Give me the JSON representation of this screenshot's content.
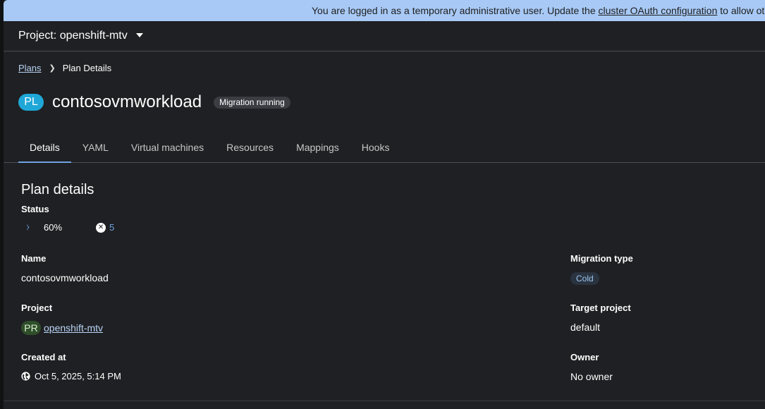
{
  "banner": {
    "text_before": "You are logged in as a temporary administrative user. Update the ",
    "link": "cluster OAuth configuration",
    "text_after": " to allow ot"
  },
  "project_bar": {
    "label": "Project: openshift-mtv",
    "dropdown_icon": "caret-down-icon"
  },
  "breadcrumb": {
    "parent": "Plans",
    "current": "Plan Details",
    "separator_icon": "chevron-right-icon"
  },
  "header": {
    "badge": "PL",
    "title": "contosovmworkload",
    "status": "Migration running"
  },
  "tabs": [
    {
      "label": "Details",
      "active": true
    },
    {
      "label": "YAML",
      "active": false
    },
    {
      "label": "Virtual machines",
      "active": false
    },
    {
      "label": "Resources",
      "active": false
    },
    {
      "label": "Mappings",
      "active": false
    },
    {
      "label": "Hooks",
      "active": false
    }
  ],
  "details": {
    "section_title": "Plan details",
    "status_label": "Status",
    "progress": "60%",
    "progress_icon": "spinner-icon",
    "error_icon": "error-circle-icon",
    "error_count": "5",
    "name_label": "Name",
    "name_value": "contosovmworkload",
    "project_label": "Project",
    "project_badge": "PR",
    "project_value": "openshift-mtv",
    "created_label": "Created at",
    "created_icon": "globe-icon",
    "created_value": "Oct 5, 2025, 5:14 PM",
    "migration_type_label": "Migration type",
    "migration_type_value": "Cold",
    "target_project_label": "Target project",
    "target_project_value": "default",
    "owner_label": "Owner",
    "owner_value": "No owner"
  },
  "colors": {
    "banner_bg": "#a8c9f5",
    "page_bg": "#1f2023",
    "accent": "#6ea4e0",
    "pl_badge": "#1fa7d8",
    "pr_badge": "#2f4e2a"
  }
}
